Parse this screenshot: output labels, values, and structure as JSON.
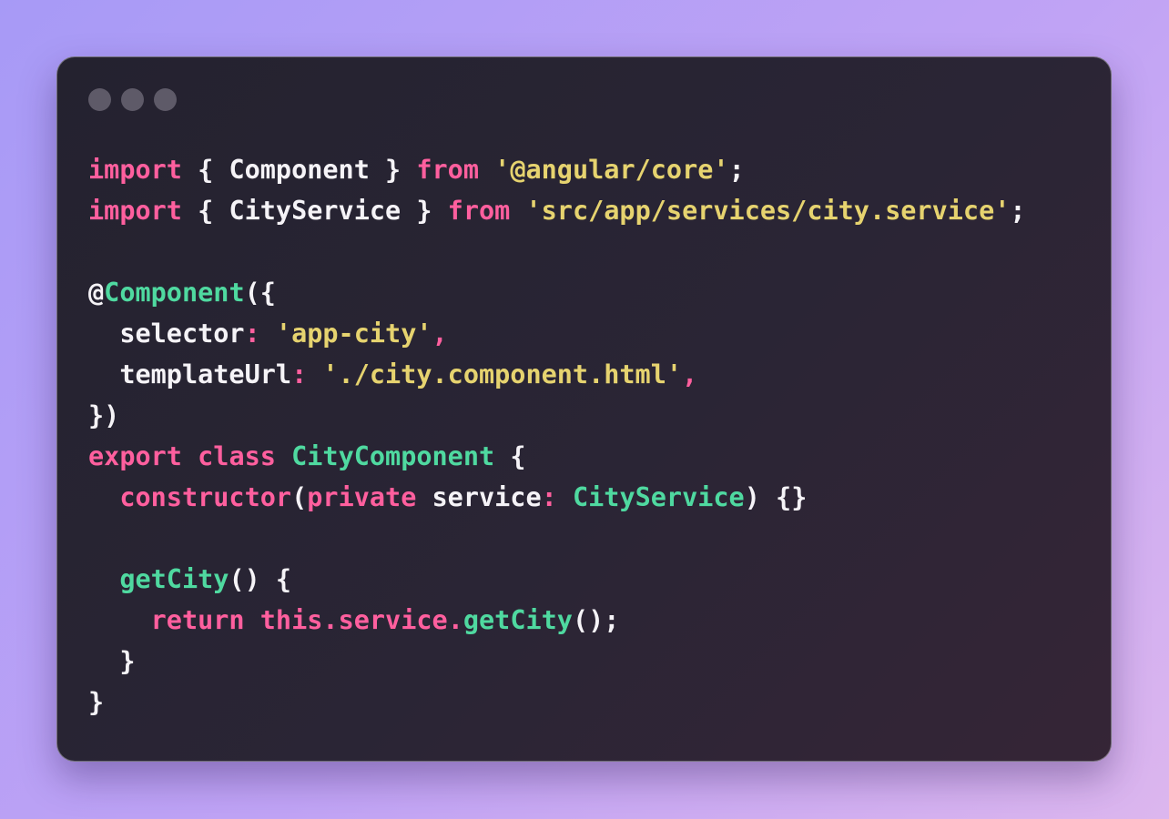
{
  "window_controls": [
    {
      "name": "close-dot-icon"
    },
    {
      "name": "minimize-dot-icon"
    },
    {
      "name": "zoom-dot-icon"
    }
  ],
  "code_lines": [
    [
      {
        "t": "import",
        "k": "keyword"
      },
      {
        "t": " { ",
        "k": "plain"
      },
      {
        "t": "Component",
        "k": "plain"
      },
      {
        "t": " } ",
        "k": "plain"
      },
      {
        "t": "from",
        "k": "keyword"
      },
      {
        "t": " ",
        "k": "plain"
      },
      {
        "t": "'@angular/core'",
        "k": "string"
      },
      {
        "t": ";",
        "k": "plain"
      }
    ],
    [
      {
        "t": "import",
        "k": "keyword"
      },
      {
        "t": " { ",
        "k": "plain"
      },
      {
        "t": "CityService",
        "k": "plain"
      },
      {
        "t": " } ",
        "k": "plain"
      },
      {
        "t": "from",
        "k": "keyword"
      },
      {
        "t": " ",
        "k": "plain"
      },
      {
        "t": "'src/app/services/city.service'",
        "k": "string"
      },
      {
        "t": ";",
        "k": "plain"
      }
    ],
    [],
    [
      {
        "t": "@",
        "k": "plain"
      },
      {
        "t": "Component",
        "k": "func"
      },
      {
        "t": "({",
        "k": "plain"
      }
    ],
    [
      {
        "t": "  selector",
        "k": "plain"
      },
      {
        "t": ": ",
        "k": "punct"
      },
      {
        "t": "'app-city'",
        "k": "string"
      },
      {
        "t": ",",
        "k": "punct"
      }
    ],
    [
      {
        "t": "  templateUrl",
        "k": "plain"
      },
      {
        "t": ": ",
        "k": "punct"
      },
      {
        "t": "'./city.component.html'",
        "k": "string"
      },
      {
        "t": ",",
        "k": "punct"
      }
    ],
    [
      {
        "t": "})",
        "k": "plain"
      }
    ],
    [
      {
        "t": "export",
        "k": "keyword"
      },
      {
        "t": " ",
        "k": "plain"
      },
      {
        "t": "class",
        "k": "keyword"
      },
      {
        "t": " ",
        "k": "plain"
      },
      {
        "t": "CityComponent",
        "k": "func"
      },
      {
        "t": " {",
        "k": "plain"
      }
    ],
    [
      {
        "t": "  ",
        "k": "plain"
      },
      {
        "t": "constructor",
        "k": "keyword"
      },
      {
        "t": "(",
        "k": "plain"
      },
      {
        "t": "private",
        "k": "keyword"
      },
      {
        "t": " service",
        "k": "plain"
      },
      {
        "t": ": ",
        "k": "punct"
      },
      {
        "t": "CityService",
        "k": "func"
      },
      {
        "t": ") {}",
        "k": "plain"
      }
    ],
    [],
    [
      {
        "t": "  ",
        "k": "plain"
      },
      {
        "t": "getCity",
        "k": "func"
      },
      {
        "t": "() {",
        "k": "plain"
      }
    ],
    [
      {
        "t": "    ",
        "k": "plain"
      },
      {
        "t": "return",
        "k": "keyword"
      },
      {
        "t": " ",
        "k": "plain"
      },
      {
        "t": "this",
        "k": "keyword"
      },
      {
        "t": ".",
        "k": "punct"
      },
      {
        "t": "service",
        "k": "keyword"
      },
      {
        "t": ".",
        "k": "punct"
      },
      {
        "t": "getCity",
        "k": "func"
      },
      {
        "t": "();",
        "k": "plain"
      }
    ],
    [
      {
        "t": "  }",
        "k": "plain"
      }
    ],
    [
      {
        "t": "}",
        "k": "plain"
      }
    ]
  ],
  "colors": {
    "keyword": "#ff5f9e",
    "plain": "#f5f3f7",
    "string": "#e6d36f",
    "func": "#4fd9a0",
    "punct": "#ff5f9e",
    "dot": "#5e5a68"
  }
}
